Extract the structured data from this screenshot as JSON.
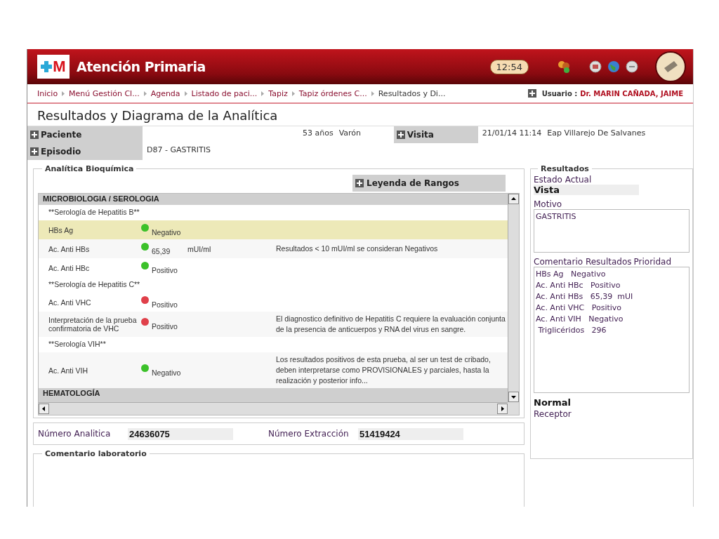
{
  "header": {
    "logo_text": "M",
    "title": "Atención Primaria",
    "clock": "12:54"
  },
  "breadcrumb": {
    "items": [
      "Inicio",
      "Menú Gestión Cl...",
      "Agenda",
      "Listado de paci...",
      "Tapiz",
      "Tapiz órdenes C...",
      "Resultados y Di..."
    ],
    "user_label": "Usuario :",
    "user_name": "Dr. MARIN CAÑADA, JAIME"
  },
  "page_title": "Resultados y Diagrama de la Analítica",
  "patient": {
    "label": "Paciente",
    "age": "53 años",
    "sex": "Varón"
  },
  "visit": {
    "label": "Visita",
    "datetime": "21/01/14 11:14",
    "center": "Eap Villarejo De Salvanes"
  },
  "episode": {
    "label": "Episodio",
    "value": "D87 - GASTRITIS"
  },
  "analitica": {
    "legend": "Analítica Bioquímica",
    "range_button": "Leyenda de Rangos",
    "rows": [
      {
        "kind": "section",
        "label": "MICROBIOLOGIA / SEROLOGIA"
      },
      {
        "kind": "group",
        "label": "**Serología de Hepatitis B**"
      },
      {
        "kind": "result",
        "name": "HBs Ag",
        "color": "#3cc12a",
        "value": "Negativo",
        "selected": true
      },
      {
        "kind": "result",
        "name": "Ac. Anti HBs",
        "color": "#3cc12a",
        "value": "65,39",
        "unit": "mUI/ml",
        "note": "Resultados < 10 mUI/ml se consideran Negativos",
        "selected": false
      },
      {
        "kind": "result",
        "name": "Ac. Anti HBc",
        "color": "#3cc12a",
        "value": "Positivo",
        "selected": false
      },
      {
        "kind": "group",
        "label": "**Serología de Hepatitis C**"
      },
      {
        "kind": "result",
        "name": "Ac. Anti VHC",
        "color": "#e0404a",
        "value": "Positivo",
        "selected": false
      },
      {
        "kind": "result",
        "name": "Interpretación de la prueba confirmatoria de VHC",
        "color": "#e0404a",
        "value": "Positivo",
        "note": "El diagnostico definitivo de Hepatitis C requiere la evaluación conjunta de la presencia de anticuerpos y RNA del virus en sangre.",
        "selected": false
      },
      {
        "kind": "group",
        "label": "**Serología VIH**"
      },
      {
        "kind": "result",
        "name": "Ac. Anti VIH",
        "color": "#3cc12a",
        "value": "Negativo",
        "note": "Los resultados positivos de esta prueba, al ser un test de cribado, deben interpretarse como PROVISIONALES y parciales, hasta la realización y posterior info...",
        "selected": false
      },
      {
        "kind": "section",
        "label": "HEMATOLOGÍA"
      }
    ]
  },
  "numbers": {
    "analitica_label": "Número Analitica",
    "analitica_value": "24636075",
    "extraccion_label": "Número Extracción",
    "extraccion_value": "51419424"
  },
  "lab_comment": {
    "legend": "Comentario laboratorio"
  },
  "resultados": {
    "legend": "Resultados",
    "estado_label": "Estado Actual",
    "estado_value": "Vista",
    "motivo_label": "Motivo",
    "motivo_value": "GASTRITIS",
    "comentario_label": "Comentario Resultados",
    "prioridad_label": "Prioridad",
    "comentario_lines": [
      "HBs Ag   Negativo",
      "Ac. Anti HBc   Positivo",
      "Ac. Anti HBs   65,39  mUI",
      "Ac. Anti VHC   Positivo",
      "Ac. Anti VIH   Negativo",
      " Triglicéridos   296"
    ],
    "prioridad_value": "Normal",
    "receptor_label": "Receptor"
  }
}
